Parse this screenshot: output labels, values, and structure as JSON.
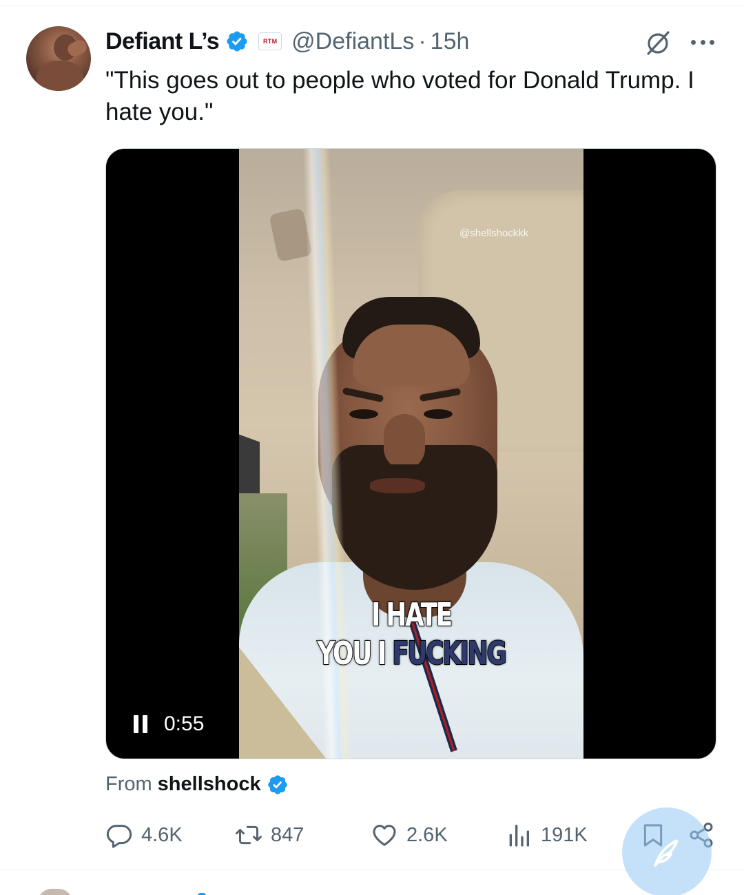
{
  "tweet": {
    "display_name": "Defiant L’s",
    "affiliate_badge": "RTM",
    "handle": "@DefiantLs",
    "separator": "·",
    "time": "15h",
    "text": "\"This goes out to people who voted for Donald Trump. I hate you.\"",
    "icons": {
      "verified": "verified-badge-icon",
      "grok": "grok-icon",
      "more": "more-options-icon"
    }
  },
  "media": {
    "watermark": "@shellshockkk",
    "caption_line1": "I HATE",
    "caption_line2_a": "YOU I ",
    "caption_line2_b": "FUCKING",
    "duration": "0:55",
    "state": "playing",
    "icons": {
      "pause": "pause-icon"
    }
  },
  "attribution": {
    "prefix": "From",
    "source": "shellshock",
    "verified_icon": "verified-badge-icon"
  },
  "actions": {
    "reply_count": "4.6K",
    "repost_count": "847",
    "like_count": "2.6K",
    "views_count": "191K",
    "icons": [
      "reply-icon",
      "repost-icon",
      "like-icon",
      "views-icon",
      "bookmark-icon",
      "share-icon",
      "compose-icon"
    ]
  },
  "colors": {
    "verified": "#1d9bf0",
    "text_primary": "#0f1419",
    "text_secondary": "#536471",
    "fab": "#96c8f5"
  }
}
